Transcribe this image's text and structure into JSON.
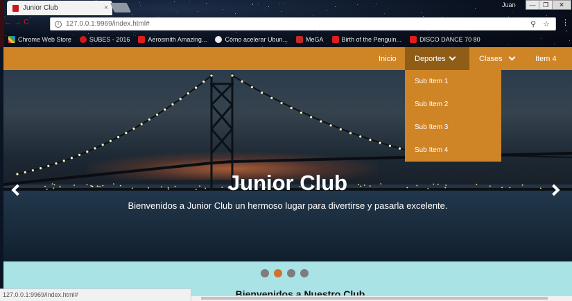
{
  "browser": {
    "tab_title": "Junior Club",
    "tab_close": "×",
    "user": "Juan",
    "win_controls": [
      "—",
      "❐",
      "✕"
    ],
    "url": "127.0.0.1:9969/index.html#",
    "nav_arrows": "← → C",
    "bookmarks": [
      {
        "label": "Chrome Web Store",
        "icon": "grid"
      },
      {
        "label": "SUBES - 2016",
        "icon": "red-circle"
      },
      {
        "label": "Aerosmith Amazing...",
        "icon": "youtube"
      },
      {
        "label": "Cómo acelerar Ubun...",
        "icon": "white-circle"
      },
      {
        "label": "MeGA",
        "icon": "m"
      },
      {
        "label": "Birth of the Penguin...",
        "icon": "youtube"
      },
      {
        "label": "DISCO DANCE 70 80",
        "icon": "youtube"
      }
    ],
    "status_url": "127.0.0.1:9969/index.html#"
  },
  "nav": {
    "items": [
      {
        "label": "Inicio"
      },
      {
        "label": "Deportes"
      },
      {
        "label": "Clases"
      },
      {
        "label": "Item 4"
      }
    ],
    "dropdown": [
      "Sub Item 1",
      "Sub Item 2",
      "Sub Item 3",
      "Sub Item 4"
    ]
  },
  "hero": {
    "title": "Junior Club",
    "subtitle": "Bienvenidos a Junior Club un hermoso lugar para divertirse y pasarla excelente."
  },
  "carousel": {
    "slide_count": 4,
    "active_index": 1
  },
  "section": {
    "heading": "Bienvenidos a Nuestro Club"
  },
  "colors": {
    "accent": "#cf8426",
    "active_nav": "#8f5d16",
    "section_bg": "#a9e3e6",
    "active_dot": "#d2712f"
  }
}
